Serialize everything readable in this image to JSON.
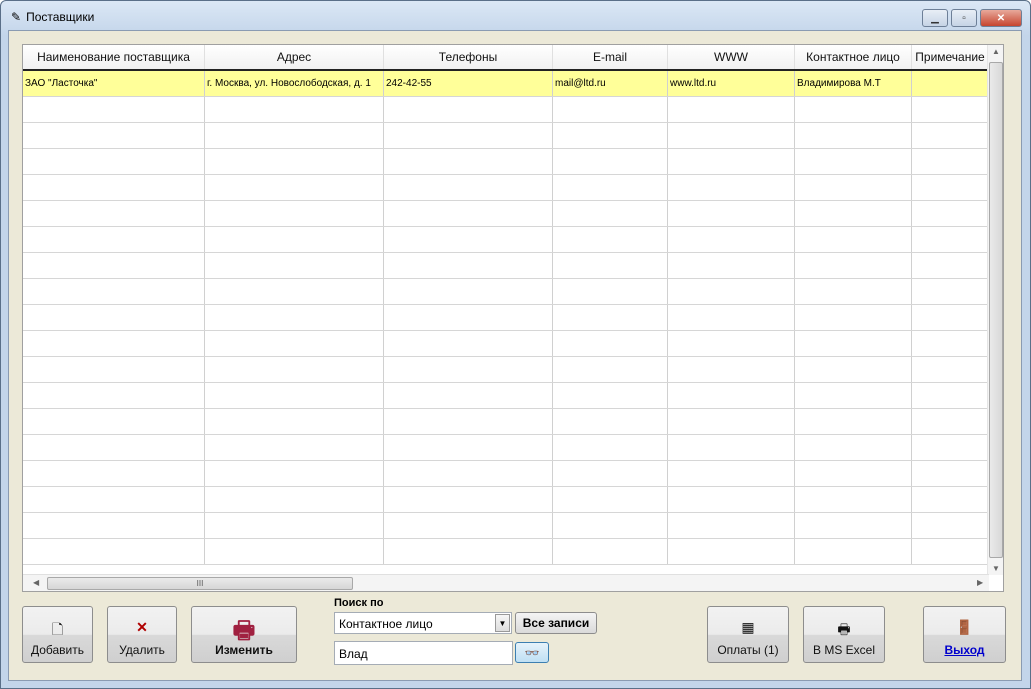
{
  "window": {
    "title": "Поставщики"
  },
  "grid": {
    "columns": [
      "Наименование поставщика",
      "Адрес",
      "Телефоны",
      "E-mail",
      "WWW",
      "Контактное лицо",
      "Примечание"
    ],
    "rows": [
      [
        "ЗАО \"Ласточка\"",
        "г. Москва, ул. Новослободская, д. 1",
        "242-42-55",
        "mail@ltd.ru",
        "www.ltd.ru",
        "Владимирова М.Т",
        ""
      ]
    ],
    "selected_row_color": "#ffff99"
  },
  "toolbar": {
    "add": "Добавить",
    "delete": "Удалить",
    "edit": "Изменить",
    "payments": "Оплаты (1)",
    "excel": "В MS Excel",
    "exit": "Выход"
  },
  "search": {
    "label": "Поиск по",
    "field": "Контактное лицо",
    "all_records": "Все записи",
    "query": "Влад"
  }
}
